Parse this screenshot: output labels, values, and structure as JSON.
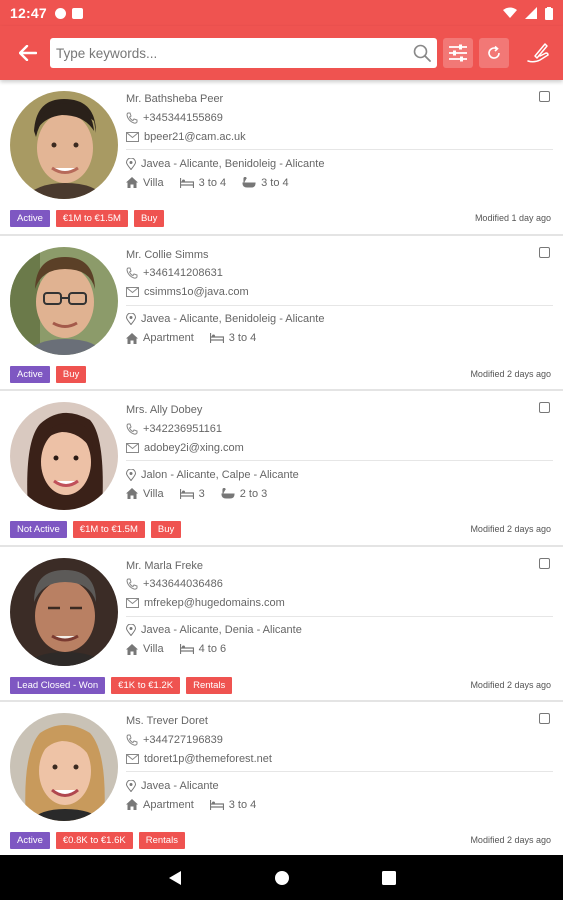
{
  "status_bar": {
    "time": "12:47"
  },
  "search": {
    "placeholder": "Type keywords..."
  },
  "colors": {
    "accent": "#ef5350",
    "status_tag": "#7e57c2"
  },
  "contacts": [
    {
      "name": "Mr. Bathsheba Peer",
      "phone": "+345344155869",
      "email": "bpeer21@cam.ac.uk",
      "location": "Javea - Alicante, Benidoleig - Alicante",
      "property_type": "Villa",
      "bedrooms": "3 to 4",
      "bathrooms": "3 to 4",
      "tags": [
        "Active",
        "€1M to €1.5M",
        "Buy"
      ],
      "modified": "Modified 1 day ago"
    },
    {
      "name": "Mr. Collie Simms",
      "phone": "+346141208631",
      "email": "csimms1o@java.com",
      "location": "Javea - Alicante, Benidoleig - Alicante",
      "property_type": "Apartment",
      "bedrooms": "3 to 4",
      "bathrooms": "",
      "tags": [
        "Active",
        "Buy"
      ],
      "modified": "Modified 2 days ago"
    },
    {
      "name": "Mrs. Ally Dobey",
      "phone": "+342236951161",
      "email": "adobey2i@xing.com",
      "location": "Jalon - Alicante, Calpe - Alicante",
      "property_type": "Villa",
      "bedrooms": "3",
      "bathrooms": "2 to 3",
      "tags": [
        "Not Active",
        "€1M to €1.5M",
        "Buy"
      ],
      "modified": "Modified 2 days ago"
    },
    {
      "name": "Mr. Marla Freke",
      "phone": "+343644036486",
      "email": "mfrekep@hugedomains.com",
      "location": "Javea - Alicante, Denia - Alicante",
      "property_type": "Villa",
      "bedrooms": "4 to 6",
      "bathrooms": "",
      "tags": [
        "Lead Closed - Won",
        "€1K to €1.2K",
        "Rentals"
      ],
      "modified": "Modified 2 days ago"
    },
    {
      "name": "Ms. Trever Doret",
      "phone": "+344727196839",
      "email": "tdoret1p@themeforest.net",
      "location": "Javea - Alicante",
      "property_type": "Apartment",
      "bedrooms": "3 to 4",
      "bathrooms": "",
      "tags": [
        "Active",
        "€0.8K to €1.6K",
        "Rentals"
      ],
      "modified": "Modified 2 days ago"
    }
  ]
}
